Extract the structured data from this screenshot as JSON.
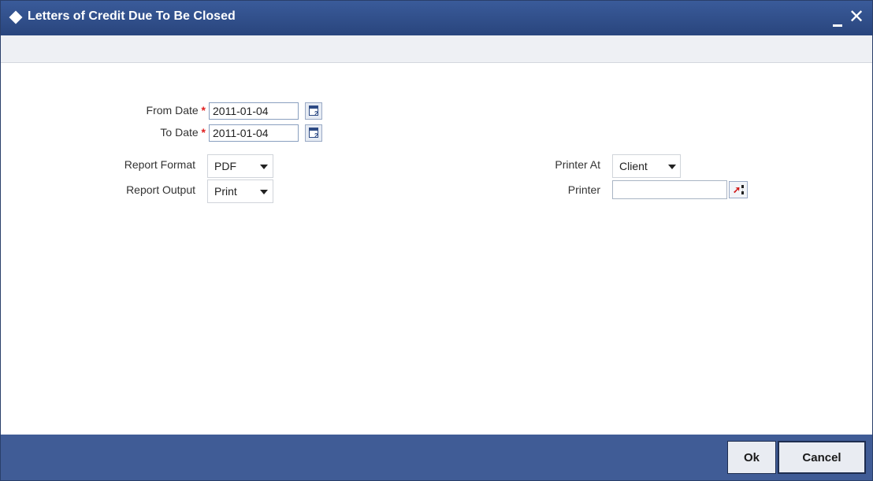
{
  "window": {
    "title": "Letters of Credit Due To Be Closed",
    "minimize_label": "minimize",
    "close_label": "close"
  },
  "form": {
    "from_date": {
      "label": "From Date",
      "required_mark": "*",
      "value": "2011-01-04"
    },
    "to_date": {
      "label": "To Date",
      "required_mark": "*",
      "value": "2011-01-04"
    },
    "report_format": {
      "label": "Report Format",
      "value": "PDF"
    },
    "report_output": {
      "label": "Report Output",
      "value": "Print"
    },
    "printer_at": {
      "label": "Printer At",
      "value": "Client"
    },
    "printer": {
      "label": "Printer",
      "value": ""
    }
  },
  "footer": {
    "ok_label": "Ok",
    "cancel_label": "Cancel"
  },
  "icons": {
    "title": "diamond-icon",
    "calendar": "calendar-icon",
    "lov": "list-of-values-icon",
    "dropdown": "chevron-down-icon"
  },
  "colors": {
    "titlebar": "#2d4a84",
    "footer": "#405c96",
    "required": "#e02020"
  }
}
